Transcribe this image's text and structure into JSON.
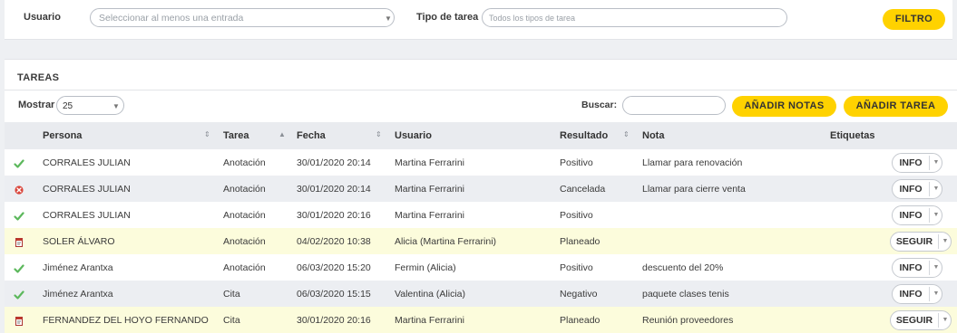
{
  "filters": {
    "usuario_label": "Usuario",
    "usuario_placeholder": "Seleccionar al menos una entrada",
    "tipo_label": "Tipo de tarea",
    "tipo_placeholder": "Todos los tipos de tarea",
    "filtro_button": "FILTRO"
  },
  "tasks": {
    "title": "TAREAS",
    "show_label": "Mostrar",
    "page_size": "25",
    "search_label": "Buscar:",
    "add_notes_button": "AÑADIR NOTAS",
    "add_task_button": "AÑADIR TAREA",
    "columns": {
      "persona": "Persona",
      "tarea": "Tarea",
      "fecha": "Fecha",
      "usuario": "Usuario",
      "resultado": "Resultado",
      "nota": "Nota",
      "etiquetas": "Etiquetas"
    },
    "rows": [
      {
        "status": "ok",
        "persona": "CORRALES JULIAN",
        "tarea": "Anotación",
        "fecha": "30/01/2020 20:14",
        "usuario": "Martina Ferrarini",
        "resultado": "Positivo",
        "nota": "Llamar para renovación",
        "action": "INFO"
      },
      {
        "status": "cancel",
        "persona": "CORRALES JULIAN",
        "tarea": "Anotación",
        "fecha": "30/01/2020 20:14",
        "usuario": "Martina Ferrarini",
        "resultado": "Cancelada",
        "nota": "Llamar para cierre venta",
        "action": "INFO"
      },
      {
        "status": "ok",
        "persona": "CORRALES JULIAN",
        "tarea": "Anotación",
        "fecha": "30/01/2020 20:16",
        "usuario": "Martina Ferrarini",
        "resultado": "Positivo",
        "nota": "",
        "action": "INFO"
      },
      {
        "status": "planned",
        "persona": "SOLER ÁLVARO",
        "tarea": "Anotación",
        "fecha": "04/02/2020 10:38",
        "usuario": "Alicia (Martina Ferrarini)",
        "resultado": "Planeado",
        "nota": "",
        "action": "SEGUIR"
      },
      {
        "status": "ok",
        "persona": "Jiménez Arantxa",
        "tarea": "Anotación",
        "fecha": "06/03/2020 15:20",
        "usuario": "Fermin (Alicia)",
        "resultado": "Positivo",
        "nota": "descuento del 20%",
        "action": "INFO"
      },
      {
        "status": "ok",
        "persona": "Jiménez Arantxa",
        "tarea": "Cita",
        "fecha": "06/03/2020 15:15",
        "usuario": "Valentina (Alicia)",
        "resultado": "Negativo",
        "nota": "paquete clases tenis",
        "action": "INFO"
      },
      {
        "status": "planned",
        "persona": "FERNANDEZ DEL HOYO FERNANDO",
        "tarea": "Cita",
        "fecha": "30/01/2020 20:16",
        "usuario": "Martina Ferrarini",
        "resultado": "Planeado",
        "nota": "Reunión proveedores",
        "action": "SEGUIR"
      }
    ]
  },
  "colors": {
    "accent_yellow": "#ffd200",
    "ok_green": "#5cb85c",
    "cancel_red": "#d9443a",
    "planned_row": "#fcfcdc"
  }
}
